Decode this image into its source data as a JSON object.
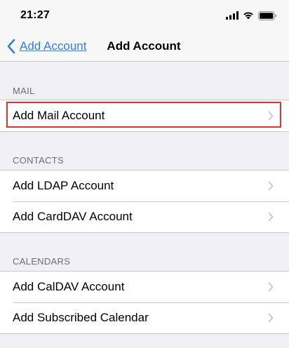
{
  "status_bar": {
    "time": "21:27",
    "icons": [
      "signal-icon",
      "wifi-icon",
      "battery-icon"
    ]
  },
  "nav": {
    "back_label": "Add Account",
    "title": "Add Account"
  },
  "sections": {
    "mail": {
      "header": "MAIL",
      "items": [
        {
          "label": "Add Mail Account"
        }
      ]
    },
    "contacts": {
      "header": "CONTACTS",
      "items": [
        {
          "label": "Add LDAP Account"
        },
        {
          "label": "Add CardDAV Account"
        }
      ]
    },
    "calendars": {
      "header": "CALENDARS",
      "items": [
        {
          "label": "Add CalDAV Account"
        },
        {
          "label": "Add Subscribed Calendar"
        }
      ]
    }
  },
  "colors": {
    "link_blue": "#2f7fd8",
    "highlight_red": "#e0332e",
    "background": "#efeff4",
    "separator": "#c8c7cc",
    "header_gray": "#6d6d72"
  }
}
